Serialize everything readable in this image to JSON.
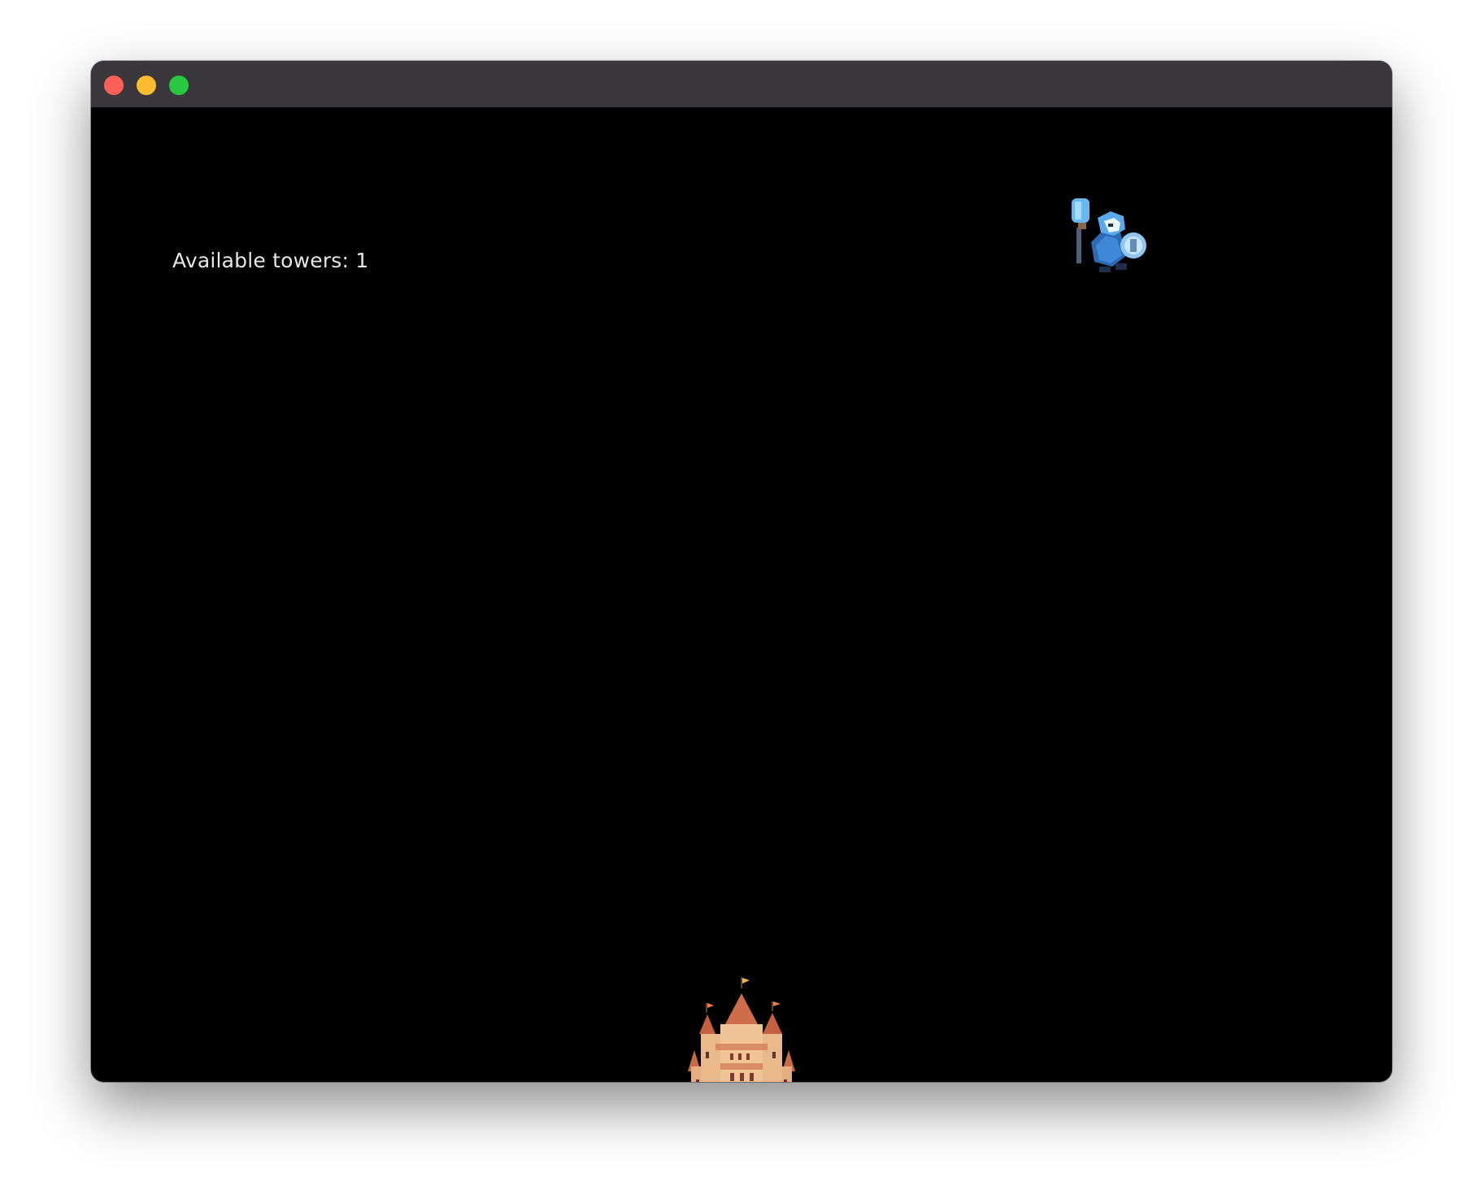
{
  "window": {
    "controls": {
      "close": "close",
      "minimize": "minimize",
      "zoom": "zoom"
    }
  },
  "game": {
    "hud": {
      "available_towers": "Available towers: 1"
    },
    "sprites": {
      "enemy": "blue-armored-knight-sprite",
      "castle": "castle-sprite"
    },
    "colors": {
      "background": "#000000",
      "titlebar": "#3a383d",
      "hud_text": "#e6e6e6"
    }
  }
}
